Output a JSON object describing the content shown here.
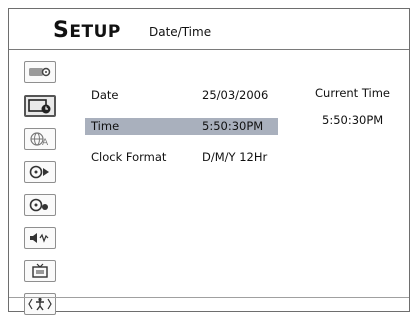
{
  "header": {
    "title_first": "S",
    "title_rest": "ETUP",
    "subtitle": "Date/Time"
  },
  "sidebar": {
    "icons": [
      {
        "name": "display-settings-icon"
      },
      {
        "name": "date-time-icon",
        "active": true
      },
      {
        "name": "language-icon"
      },
      {
        "name": "playback-icon"
      },
      {
        "name": "record-icon"
      },
      {
        "name": "audio-icon"
      },
      {
        "name": "tv-icon"
      },
      {
        "name": "system-icon"
      }
    ]
  },
  "settings": {
    "rows": [
      {
        "label": "Date",
        "value": "25/03/2006"
      },
      {
        "label": "Time",
        "value": "5:50:30PM",
        "selected": true
      },
      {
        "label": "Clock Format",
        "value": "D/M/Y 12Hr"
      }
    ]
  },
  "current_time": {
    "label": "Current Time",
    "value": "5:50:30PM"
  },
  "colors": {
    "highlight": "#a9b0bd",
    "border": "#6e6e6e"
  }
}
